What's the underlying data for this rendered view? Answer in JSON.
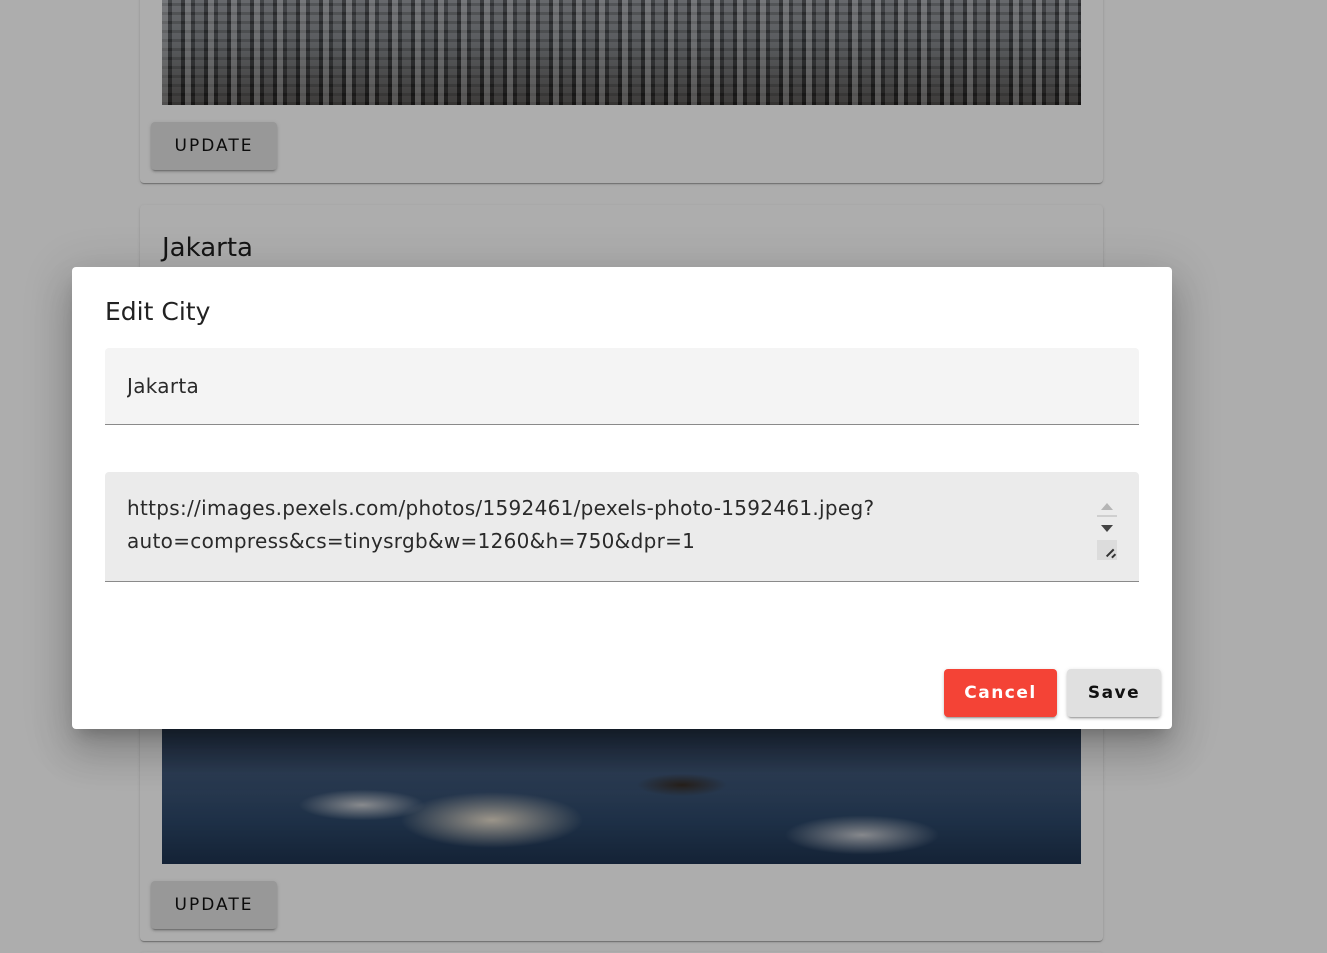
{
  "background_cards": [
    {
      "image_alt": "city skyline",
      "update_label": "UPDATE"
    },
    {
      "title": "Jakarta",
      "image_alt": "lake reflection",
      "update_label": "UPDATE"
    }
  ],
  "dialog": {
    "title": "Edit City",
    "name_value": "Jakarta",
    "url_value": "https://images.pexels.com/photos/1592461/pexels-photo-1592461.jpeg?auto=compress&cs=tinysrgb&w=1260&h=750&dpr=1",
    "cancel_label": "Cancel",
    "save_label": "Save"
  },
  "colors": {
    "cancel_bg": "#f44336",
    "save_bg": "#e0e0e0",
    "overlay": "rgba(0,0,0,0.32)"
  }
}
